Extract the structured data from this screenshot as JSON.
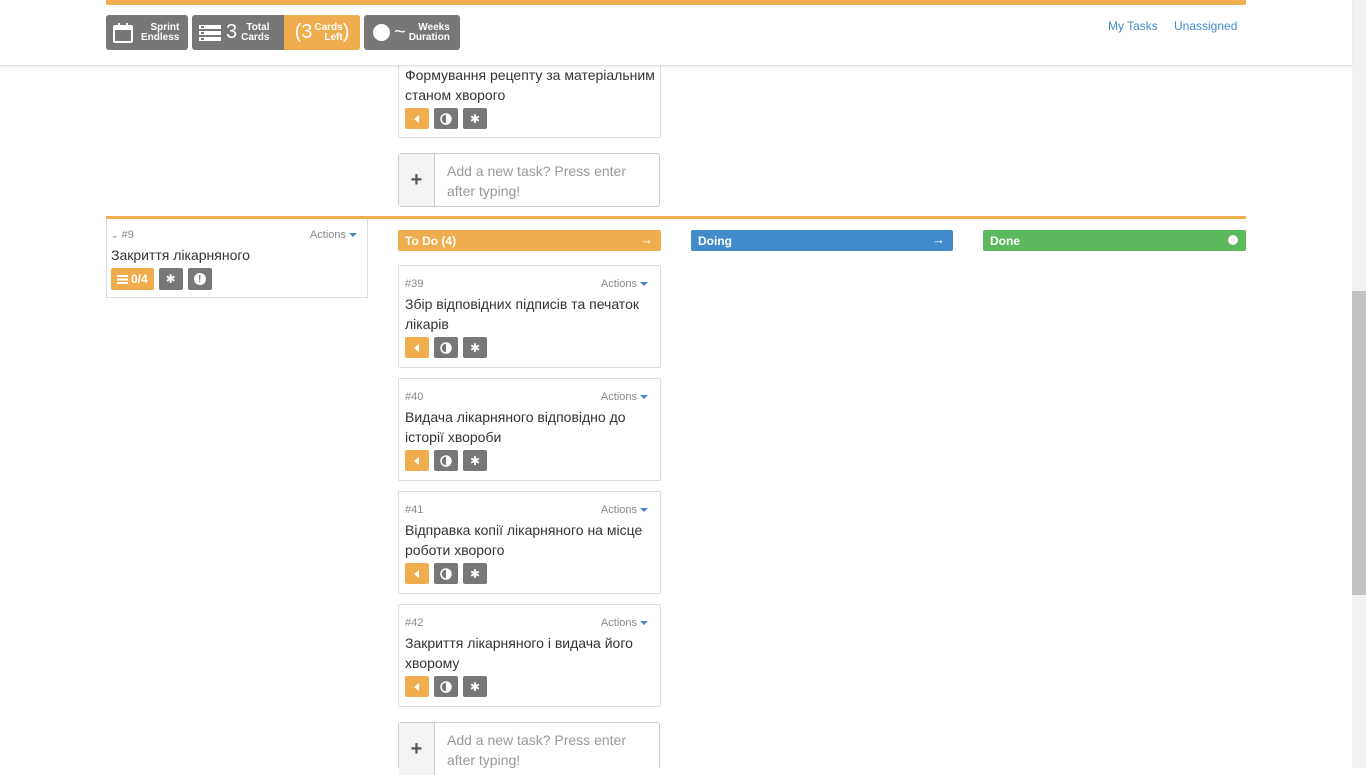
{
  "header": {
    "sprint": {
      "line1": "Sprint",
      "line2": "Endless"
    },
    "total": {
      "count": "3",
      "line1": "Total",
      "line2": "Cards"
    },
    "left": {
      "open_paren": "(",
      "count": "3",
      "line1": "Cards",
      "line2": "Left",
      "close_paren": ")"
    },
    "weeks": {
      "value": "~",
      "line1": "Weeks",
      "line2": "Duration"
    },
    "links": {
      "my_tasks": "My Tasks",
      "unassigned": "Unassigned"
    }
  },
  "top_card": {
    "title": "Формування рецепту за матеріальним станом хворого"
  },
  "add_task": {
    "placeholder": "Add a new task? Press enter after typing!",
    "plus": "+"
  },
  "story": {
    "number": "#9",
    "actions": "Actions",
    "title": "Закриття лікарняного",
    "badge_count": "0/4"
  },
  "columns": {
    "todo": "To Do (4)",
    "doing": "Doing",
    "done": "Done"
  },
  "cards": [
    {
      "number": "#39",
      "actions": "Actions",
      "title": "Збір відповідних підписів та печаток лікарів"
    },
    {
      "number": "#40",
      "actions": "Actions",
      "title": "Видача лікарняного відповідно до історії хвороби"
    },
    {
      "number": "#41",
      "actions": "Actions",
      "title": "Відправка копії лікарняного на місце роботи хворого"
    },
    {
      "number": "#42",
      "actions": "Actions",
      "title": "Закриття лікарняного і видача його хворому"
    }
  ],
  "colors": {
    "orange": "#f0ad4e",
    "blue": "#428bca",
    "green": "#5cb85c",
    "grey": "#777777"
  },
  "icons": [
    "calendar-icon",
    "stack-icon",
    "circle-icon",
    "speaker-icon",
    "half-circle-icon",
    "asterisk-icon",
    "exclamation-icon",
    "arrow-right-icon",
    "chevron-down-icon"
  ]
}
